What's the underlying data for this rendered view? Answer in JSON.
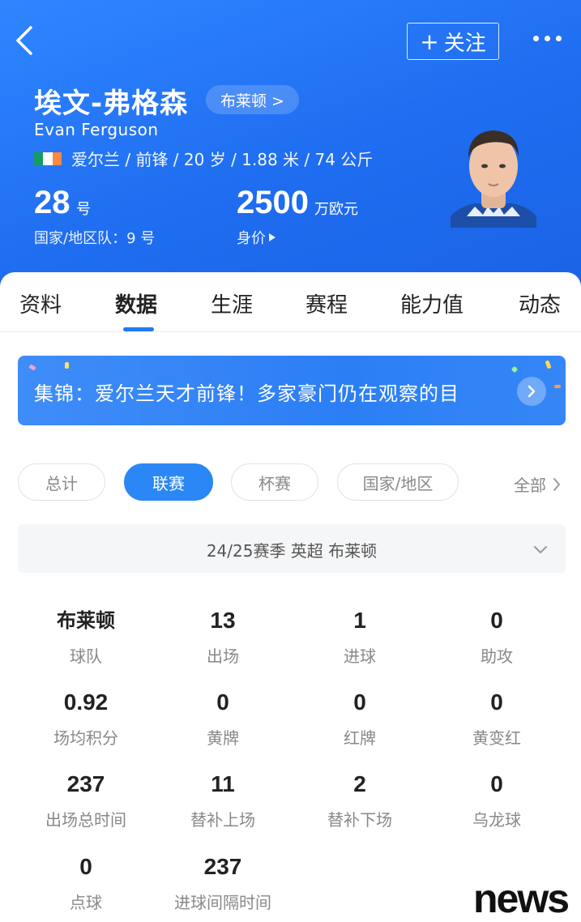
{
  "header": {
    "follow_label": "关注",
    "name_cn": "埃文-弗格森",
    "team_chip": "布莱顿 >",
    "name_en": "Evan Ferguson",
    "meta": "爱尔兰 / 前锋 / 20 岁 / 1.88 米 / 74 公斤",
    "shirt_number": "28",
    "shirt_unit": "号",
    "national_number": "国家/地区队：9 号",
    "market_value": "2500",
    "market_unit": "万欧元",
    "market_label": "身价",
    "flag_colors": [
      "#169b62",
      "#ffffff",
      "#ff883e"
    ]
  },
  "tabs": [
    {
      "label": "资料"
    },
    {
      "label": "数据"
    },
    {
      "label": "生涯"
    },
    {
      "label": "赛程"
    },
    {
      "label": "能力值"
    },
    {
      "label": "动态"
    }
  ],
  "active_tab": "数据",
  "banner": {
    "text": "集锦：爱尔兰天才前锋！多家豪门仍在观察的目"
  },
  "filters": {
    "chips": [
      {
        "label": "总计"
      },
      {
        "label": "联赛"
      },
      {
        "label": "杯赛"
      },
      {
        "label": "国家/地区"
      }
    ],
    "active": "联赛",
    "all_label": "全部"
  },
  "season": {
    "label": "24/25赛季 英超 布莱顿"
  },
  "stats": [
    {
      "value": "布莱顿",
      "label": "球队"
    },
    {
      "value": "13",
      "label": "出场"
    },
    {
      "value": "1",
      "label": "进球"
    },
    {
      "value": "0",
      "label": "助攻"
    },
    {
      "value": "0.92",
      "label": "场均积分"
    },
    {
      "value": "0",
      "label": "黄牌"
    },
    {
      "value": "0",
      "label": "红牌"
    },
    {
      "value": "0",
      "label": "黄变红"
    },
    {
      "value": "237",
      "label": "出场总时间"
    },
    {
      "value": "11",
      "label": "替补上场"
    },
    {
      "value": "2",
      "label": "替补下场"
    },
    {
      "value": "0",
      "label": "乌龙球"
    },
    {
      "value": "0",
      "label": "点球"
    },
    {
      "value": "237",
      "label": "进球间隔时间"
    }
  ],
  "watermark": "news",
  "colors": {
    "header_blue": "#1f6df0",
    "accent": "#2a87f5"
  }
}
